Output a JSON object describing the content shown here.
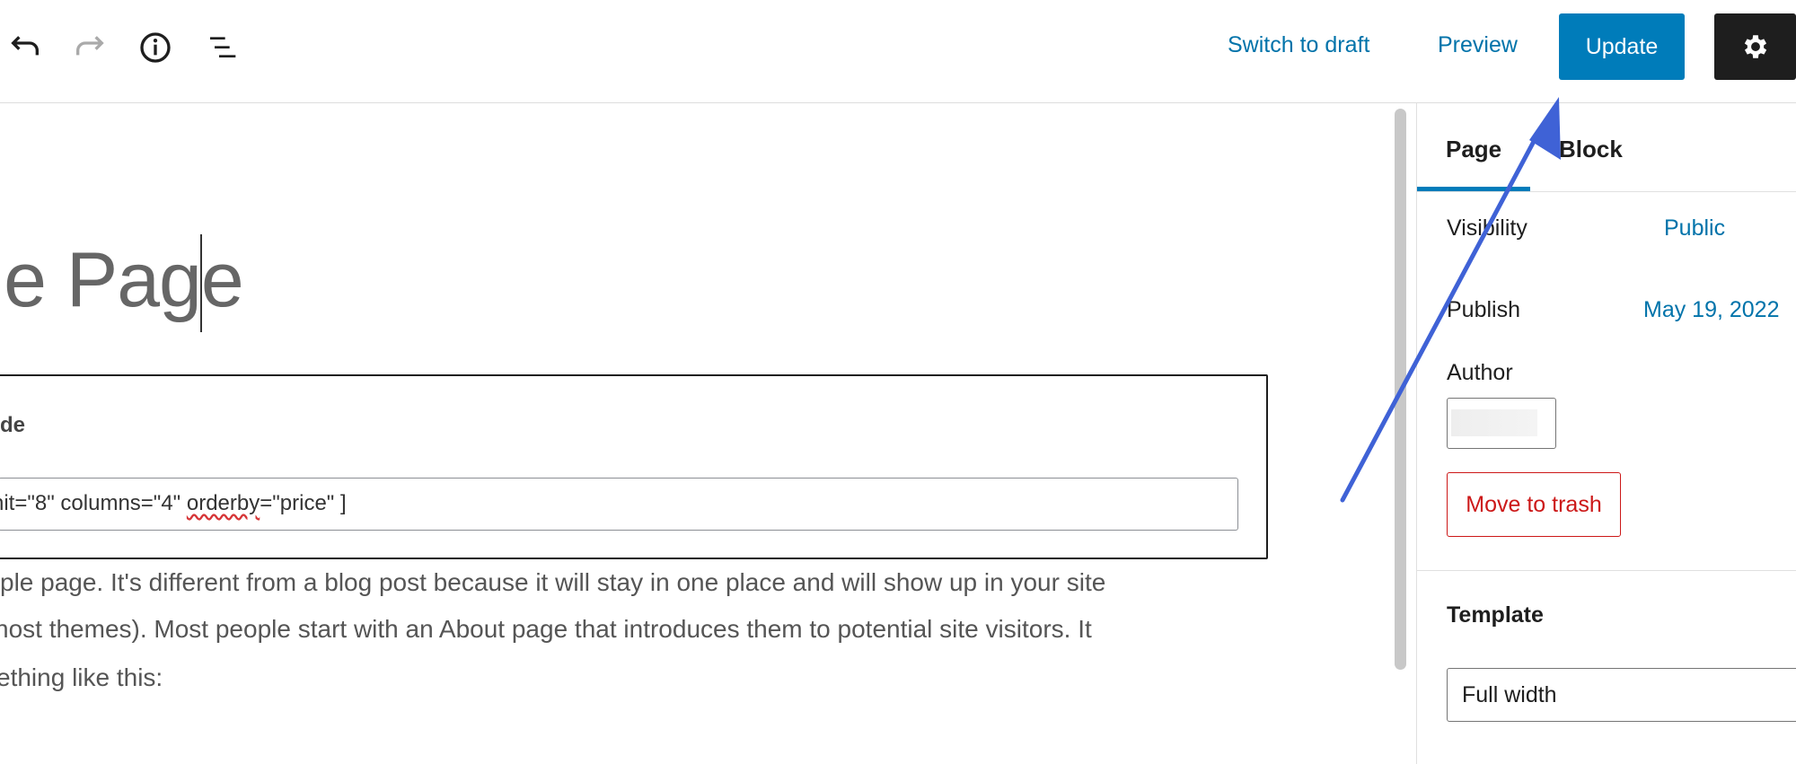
{
  "toolbar": {
    "undo_icon": "undo-icon",
    "redo_icon": "redo-icon",
    "info_icon": "info-icon",
    "list_view_icon": "list-view-icon",
    "switch_to_draft": "Switch to draft",
    "preview": "Preview",
    "update": "Update",
    "settings_icon": "gear-icon"
  },
  "editor": {
    "title": "le Page",
    "shortcode_block": {
      "label": "de",
      "value_prefix": "nit=\"8\" columns=\"4\" ",
      "value_misspelled": "orderby",
      "value_suffix": "=\"price\" ]"
    },
    "paragraph": [
      "ple page. It's different from a blog post because it will stay in one place and will show up in your site",
      "nost themes). Most people start with an About page that introduces them to potential site visitors. It",
      "ething like this:"
    ]
  },
  "sidebar": {
    "tabs": [
      {
        "label": "Page",
        "active": true
      },
      {
        "label": "Block",
        "active": false
      }
    ],
    "visibility_label": "Visibility",
    "visibility_value": "Public",
    "publish_label": "Publish",
    "publish_value": "May 19, 2022",
    "author_label": "Author",
    "move_to_trash": "Move to trash",
    "template_label": "Template",
    "template_value": "Full width"
  },
  "colors": {
    "accent": "#007cba",
    "danger": "#cc1818",
    "annotation_arrow": "#3f62d6"
  }
}
